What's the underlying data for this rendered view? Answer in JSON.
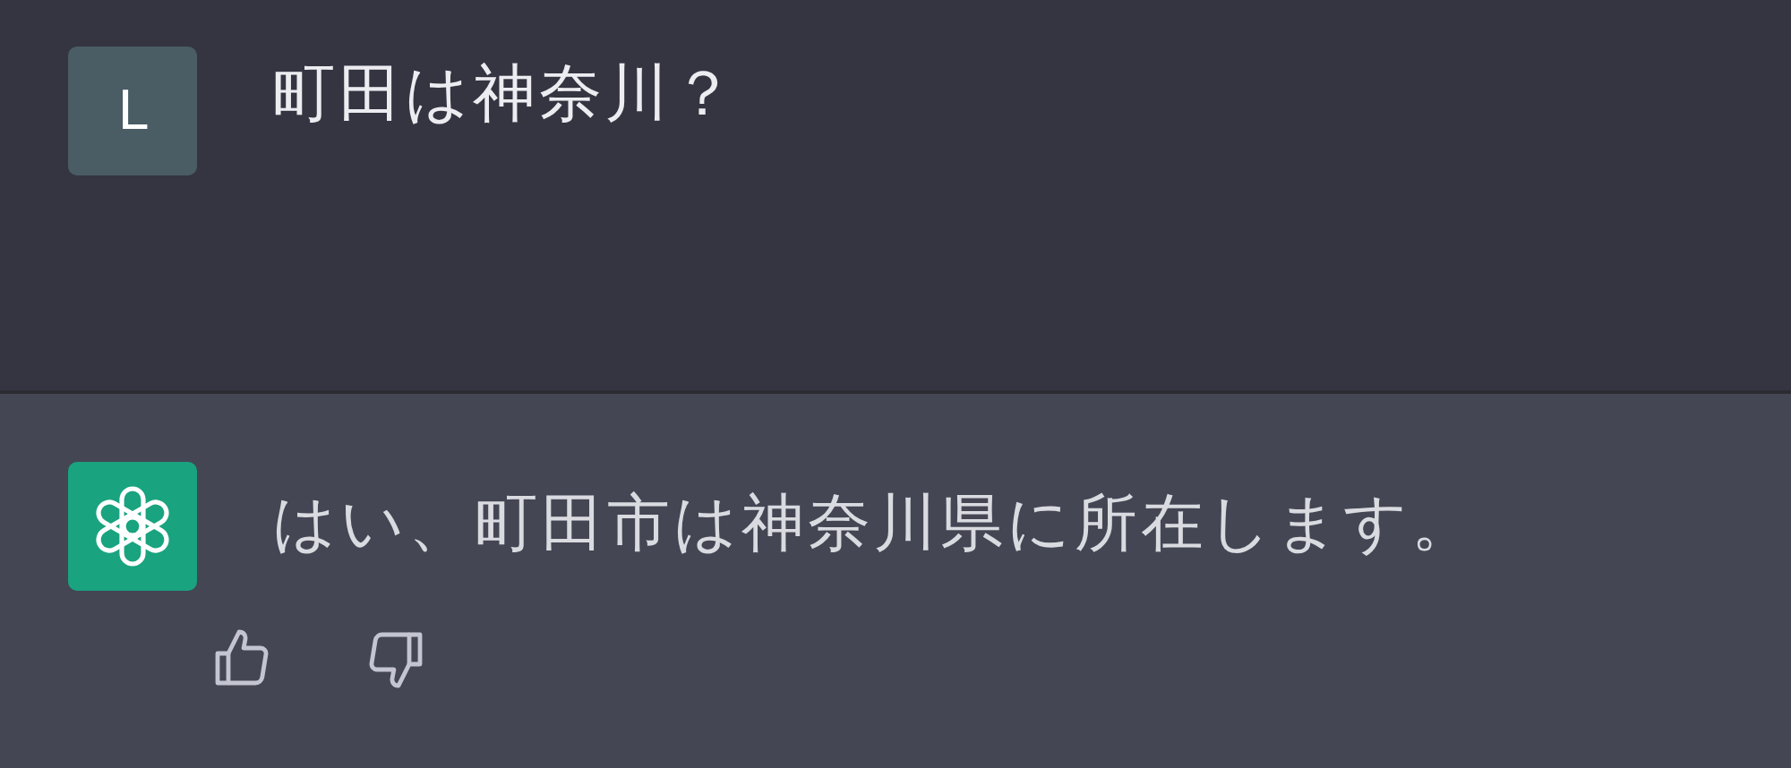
{
  "messages": [
    {
      "kind": "user",
      "avatar": "L",
      "text": "町田は神奈川？"
    },
    {
      "kind": "assistant",
      "text": "はい、町田市は神奈川県に所在します。"
    }
  ]
}
